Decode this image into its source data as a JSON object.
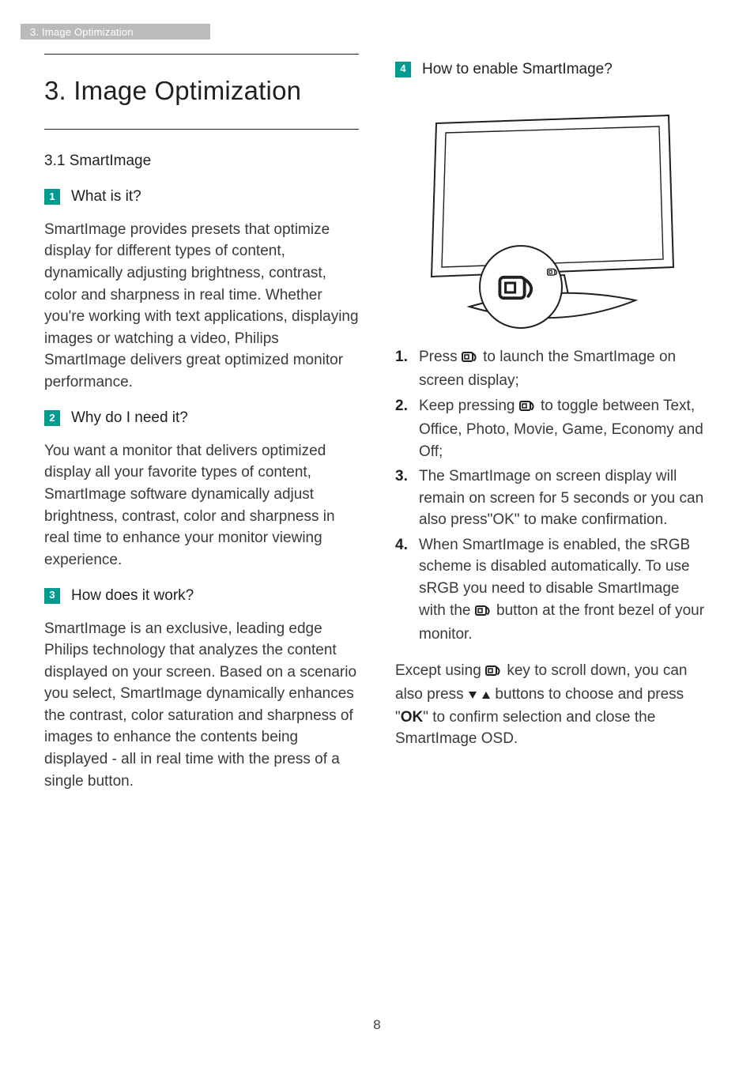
{
  "header": {
    "breadcrumb": "3. Image Optimization"
  },
  "page_number": "8",
  "left": {
    "title": "3.  Image Optimization",
    "subsection": "3.1 SmartImage",
    "q1": {
      "num": "1",
      "label": "What is it?"
    },
    "p1": "SmartImage provides presets that optimize display for different types of content, dynamically adjusting brightness, contrast, color and sharpness in real time. Whether you're working with text applications, displaying images or watching a video, Philips SmartImage delivers great optimized monitor performance.",
    "q2": {
      "num": "2",
      "label": "Why do I need it?"
    },
    "p2": "You want a monitor that delivers optimized display all your favorite types of content, SmartImage software dynamically adjust brightness, contrast, color and sharpness in real time to enhance your monitor viewing experience.",
    "q3": {
      "num": "3",
      "label": "How does it work?"
    },
    "p3": "SmartImage is an exclusive, leading edge Philips technology that analyzes the content displayed on your screen. Based on a scenario you select, SmartImage dynamically enhances the contrast, color saturation and sharpness of images to enhance the contents being displayed - all in real time with the press of a single button."
  },
  "right": {
    "q4": {
      "num": "4",
      "label": "How to enable SmartImage?"
    },
    "steps": {
      "s1a": "Press ",
      "s1b": " to launch the SmartImage on screen display;",
      "s2a": "Keep pressing ",
      "s2b": " to toggle between Text, Office, Photo, Movie, Game, Economy and Off;",
      "s3": "The SmartImage on screen display will remain on screen for 5 seconds or you can also press\"OK\" to make confirmation.",
      "s4a": "When SmartImage is enabled, the sRGB scheme is disabled automatically. To use sRGB you need to disable SmartImage with the ",
      "s4b": " button at the front bezel of your monitor."
    },
    "closing": {
      "a": "Except using ",
      "b": " key to scroll down, you can also press ",
      "c": " buttons to choose and press \"",
      "ok": "OK",
      "d": "\" to confirm selection and close the SmartImage OSD."
    }
  }
}
